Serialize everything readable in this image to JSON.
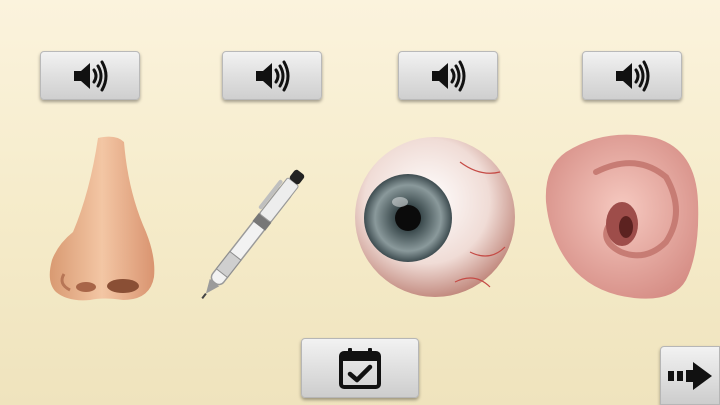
{
  "audio_buttons": [
    {
      "icon": "speaker-icon",
      "target": "nose"
    },
    {
      "icon": "speaker-icon",
      "target": "pen"
    },
    {
      "icon": "speaker-icon",
      "target": "eye"
    },
    {
      "icon": "speaker-icon",
      "target": "ear"
    }
  ],
  "cards": [
    {
      "image": "nose-image"
    },
    {
      "image": "pen-image"
    },
    {
      "image": "eye-image"
    },
    {
      "image": "ear-image"
    }
  ],
  "footer": {
    "check_icon": "calendar-check-icon",
    "next_icon": "arrow-right-icon"
  },
  "colors": {
    "background": "#f8efd2",
    "button_face": "#dedede",
    "icon": "#111111"
  }
}
